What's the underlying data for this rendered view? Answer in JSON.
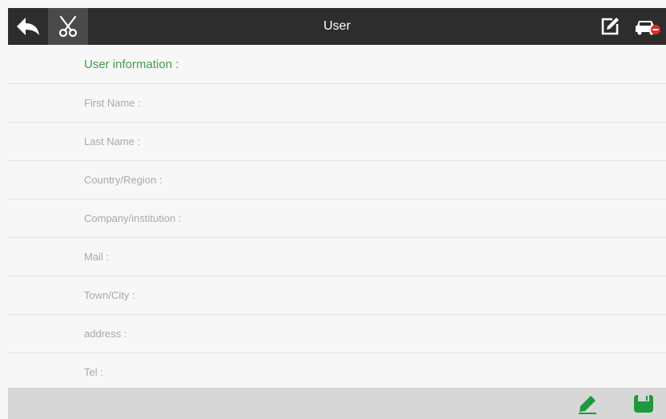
{
  "header": {
    "title": "User",
    "back_icon": "back-arrow-icon",
    "cut_icon": "scissors-icon",
    "edit_icon": "edit-note-icon",
    "car_icon": "car-disconnect-icon"
  },
  "form": {
    "section_title": "User information :",
    "fields": [
      {
        "label": "First Name :"
      },
      {
        "label": "Last Name :"
      },
      {
        "label": "Country/Region :"
      },
      {
        "label": "Company/institution :"
      },
      {
        "label": "Mail :"
      },
      {
        "label": "Town/City :"
      },
      {
        "label": "address :"
      },
      {
        "label": "Tel :"
      }
    ]
  },
  "footer": {
    "pencil_icon": "pencil-icon",
    "save_icon": "save-icon"
  },
  "colors": {
    "topbar": "#2d2d2d",
    "accent_green": "#3f9e4f",
    "icon_green": "#1e9a3c",
    "bottombar": "#d7d7d7",
    "car_red": "#e02a2a"
  }
}
